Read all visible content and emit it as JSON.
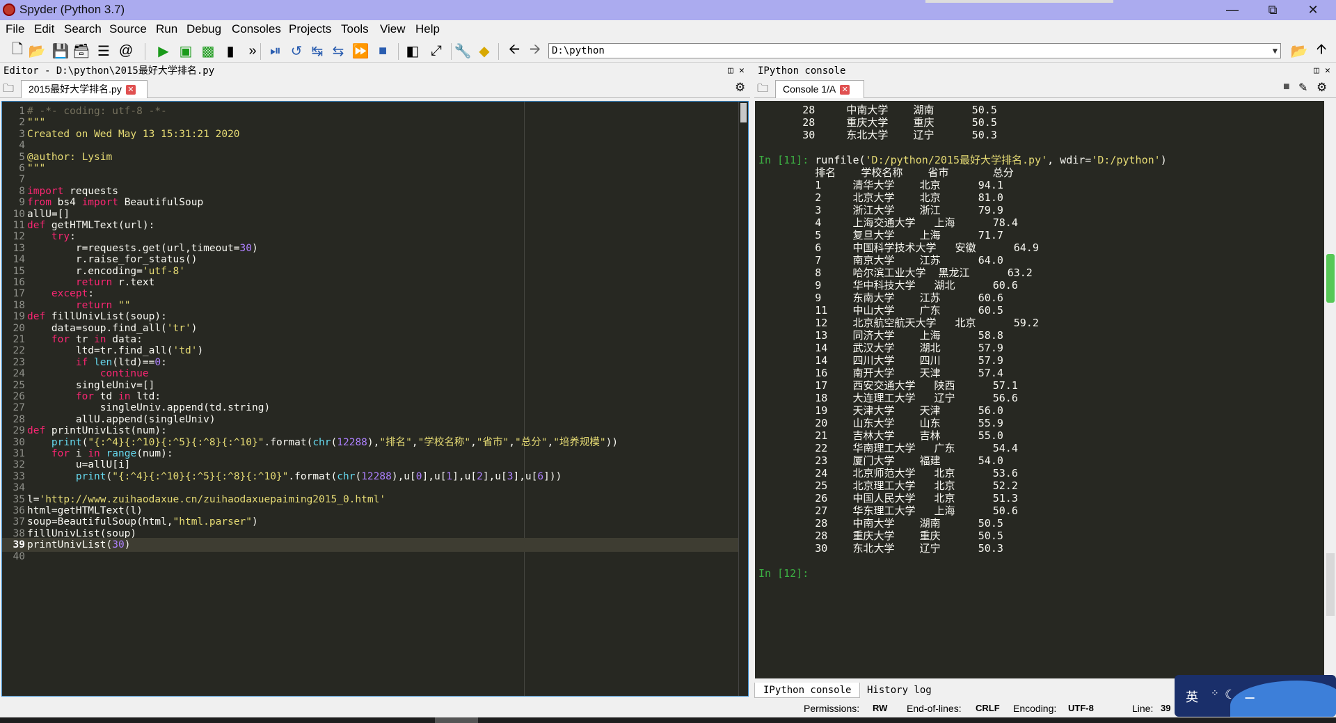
{
  "window": {
    "title": "Spyder (Python 3.7)"
  },
  "menu": [
    {
      "label": "File"
    },
    {
      "label": "Edit"
    },
    {
      "label": "Search"
    },
    {
      "label": "Source"
    },
    {
      "label": "Run"
    },
    {
      "label": "Debug"
    },
    {
      "label": "Consoles"
    },
    {
      "label": "Projects"
    },
    {
      "label": "Tools"
    },
    {
      "label": "View"
    },
    {
      "label": "Help"
    }
  ],
  "toolbar": {
    "path": "D:\\python"
  },
  "editor": {
    "header": "Editor - D:\\python\\2015最好大学排名.py",
    "tab_label": "2015最好大学排名.py",
    "lines": [
      {
        "n": "1",
        "t": "# -*- coding: utf-8 -*-"
      },
      {
        "n": "2",
        "t": "\"\"\""
      },
      {
        "n": "3",
        "t": "Created on Wed May 13 15:31:21 2020"
      },
      {
        "n": "4",
        "t": ""
      },
      {
        "n": "5",
        "t": "@author: Lysim"
      },
      {
        "n": "6",
        "t": "\"\"\""
      },
      {
        "n": "7",
        "t": ""
      },
      {
        "n": "8",
        "t": "import requests"
      },
      {
        "n": "9",
        "t": "from bs4 import BeautifulSoup"
      },
      {
        "n": "10",
        "t": "allU=[]"
      },
      {
        "n": "11",
        "t": "def getHTMLText(url):"
      },
      {
        "n": "12",
        "t": "    try:"
      },
      {
        "n": "13",
        "t": "        r=requests.get(url,timeout=30)"
      },
      {
        "n": "14",
        "t": "        r.raise_for_status()"
      },
      {
        "n": "15",
        "t": "        r.encoding='utf-8'"
      },
      {
        "n": "16",
        "t": "        return r.text"
      },
      {
        "n": "17",
        "t": "    except:"
      },
      {
        "n": "18",
        "t": "        return \"\""
      },
      {
        "n": "19",
        "t": "def fillUnivList(soup):"
      },
      {
        "n": "20",
        "t": "    data=soup.find_all('tr')"
      },
      {
        "n": "21",
        "t": "    for tr in data:"
      },
      {
        "n": "22",
        "t": "        ltd=tr.find_all('td')"
      },
      {
        "n": "23",
        "t": "        if len(ltd)==0:"
      },
      {
        "n": "24",
        "t": "            continue"
      },
      {
        "n": "25",
        "t": "        singleUniv=[]"
      },
      {
        "n": "26",
        "t": "        for td in ltd:"
      },
      {
        "n": "27",
        "t": "            singleUniv.append(td.string)"
      },
      {
        "n": "28",
        "t": "        allU.append(singleUniv)"
      },
      {
        "n": "29",
        "t": "def printUnivList(num):"
      },
      {
        "n": "30",
        "t": "    print(\"{:^4}{:^10}{:^5}{:^8}{:^10}\".format(chr(12288),\"排名\",\"学校名称\",\"省市\",\"总分\",\"培养规模\"))"
      },
      {
        "n": "31",
        "t": "    for i in range(num):"
      },
      {
        "n": "32",
        "t": "        u=allU[i]"
      },
      {
        "n": "33",
        "t": "        print(\"{:^4}{:^10}{:^5}{:^8}{:^10}\".format(chr(12288),u[0],u[1],u[2],u[3],u[6]))"
      },
      {
        "n": "34",
        "t": ""
      },
      {
        "n": "35",
        "t": "l='http://www.zuihaodaxue.cn/zuihaodaxuepaiming2015_0.html'"
      },
      {
        "n": "36",
        "t": "html=getHTMLText(l)"
      },
      {
        "n": "37",
        "t": "soup=BeautifulSoup(html,\"html.parser\")"
      },
      {
        "n": "38",
        "t": "fillUnivList(soup)"
      },
      {
        "n": "39",
        "t": "printUnivList(30)"
      },
      {
        "n": "40",
        "t": ""
      }
    ]
  },
  "console": {
    "header": "IPython console",
    "tab_label": "Console 1/A",
    "lines": [
      "       28     中南大学    湖南      50.5",
      "       28     重庆大学    重庆      50.5",
      "       30     东北大学    辽宁      50.3",
      "",
      "In [11]: runfile('D:/python/2015最好大学排名.py', wdir='D:/python')",
      "         排名    学校名称    省市       总分",
      "         1     清华大学    北京      94.1",
      "         2     北京大学    北京      81.0",
      "         3     浙江大学    浙江      79.9",
      "         4     上海交通大学   上海      78.4",
      "         5     复旦大学    上海      71.7",
      "         6     中国科学技术大学   安徽      64.9",
      "         7     南京大学    江苏      64.0",
      "         8     哈尔滨工业大学  黑龙江      63.2",
      "         9     华中科技大学   湖北      60.6",
      "         9     东南大学    江苏      60.6",
      "         11    中山大学    广东      60.5",
      "         12    北京航空航天大学   北京      59.2",
      "         13    同济大学    上海      58.8",
      "         14    武汉大学    湖北      57.9",
      "         14    四川大学    四川      57.9",
      "         16    南开大学    天津      57.4",
      "         17    西安交通大学   陕西      57.1",
      "         18    大连理工大学   辽宁      56.6",
      "         19    天津大学    天津      56.0",
      "         20    山东大学    山东      55.9",
      "         21    吉林大学    吉林      55.0",
      "         22    华南理工大学   广东      54.4",
      "         23    厦门大学    福建      54.0",
      "         24    北京师范大学   北京      53.6",
      "         25    北京理工大学   北京      52.2",
      "         26    中国人民大学   北京      51.3",
      "         27    华东理工大学   上海      50.6",
      "         28    中南大学    湖南      50.5",
      "         28    重庆大学    重庆      50.5",
      "         30    东北大学    辽宁      50.3",
      "",
      "In [12]:"
    ],
    "bottom_tabs": [
      "IPython console",
      "History log"
    ]
  },
  "status": {
    "permissions_label": "Permissions:",
    "permissions": "RW",
    "eol_label": "End-of-lines:",
    "eol": "CRLF",
    "encoding_label": "Encoding:",
    "encoding": "UTF-8",
    "line_label": "Line:",
    "line": "39"
  },
  "ime": {
    "label": "英"
  }
}
